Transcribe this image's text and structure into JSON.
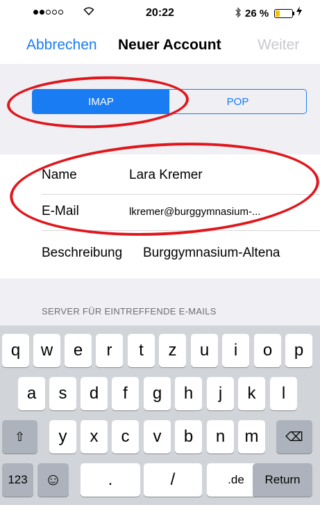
{
  "status_bar": {
    "carrier_dots": [
      true,
      true,
      false,
      false,
      false
    ],
    "wifi_icon": "wifi-icon",
    "time": "20:22",
    "bluetooth_icon": "bluetooth-icon",
    "battery_percent": "26 %",
    "battery_level": 0.26,
    "battery_color": "#f5c400",
    "charging_icon": "bolt-icon"
  },
  "nav": {
    "cancel": "Abbrechen",
    "title": "Neuer Account",
    "next": "Weiter",
    "accent": "#1a7cf2"
  },
  "segmented": {
    "options": [
      "IMAP",
      "POP"
    ],
    "selected": "IMAP"
  },
  "form": {
    "rows": [
      {
        "label": "Name",
        "value": "Lara Kremer"
      },
      {
        "label": "E-Mail",
        "value": "lkremer@burggymnasium-..."
      },
      {
        "label": "Beschreibung",
        "value": "Burggymnasium-Altena"
      }
    ]
  },
  "section_header": "SERVER FÜR EINTREFFENDE E-MAILS",
  "keyboard": {
    "row1": [
      "q",
      "w",
      "e",
      "r",
      "t",
      "z",
      "u",
      "i",
      "o",
      "p"
    ],
    "row2": [
      "a",
      "s",
      "d",
      "f",
      "g",
      "h",
      "j",
      "k",
      "l"
    ],
    "row3": [
      "y",
      "x",
      "c",
      "v",
      "b",
      "n",
      "m"
    ],
    "shift": "⇧",
    "delete": "⌫",
    "numbers": "123",
    "emoji": "☺",
    "dot": ".",
    "slash": "/",
    "de": ".de",
    "return": "Return"
  },
  "annotation_color": "#e0161b"
}
